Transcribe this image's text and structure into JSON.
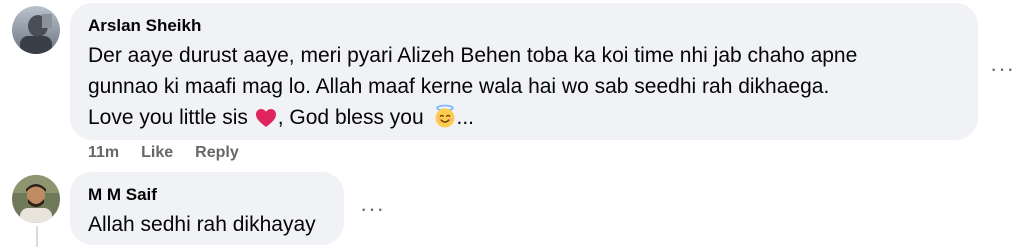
{
  "comments": [
    {
      "author": "Arslan Sheikh",
      "text_line1": "Der aaye durust aaye, meri pyari Alizeh Behen toba ka koi time nhi jab chaho apne",
      "text_line2": "gunnao ki maafi mag lo. Allah maaf kerne wala hai wo sab seedhi rah dikhaega.",
      "text_line3_a": "Love you little sis ",
      "text_line3_b": ", God bless you ",
      "text_line3_c": "...",
      "heart_emoji": "heart-emoji",
      "face_emoji": "smiling-face-with-halo-emoji",
      "time": "11m",
      "like_label": "Like",
      "reply_label": "Reply",
      "more_label": "···"
    },
    {
      "author": "M M Saif",
      "text": "Allah sedhi rah dikhayay",
      "more_label": "···"
    }
  ],
  "colors": {
    "bubble_bg": "#f0f2f5",
    "meta_text": "#65676b",
    "main_text": "#050505",
    "heart": "#e0245e"
  }
}
